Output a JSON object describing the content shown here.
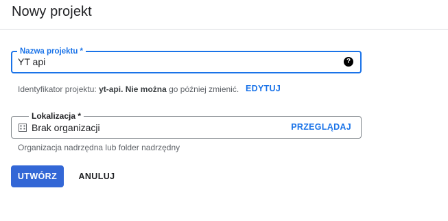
{
  "header": {
    "title": "Nowy projekt"
  },
  "project_name": {
    "label": "Nazwa projektu *",
    "value": "YT api",
    "help_icon": "help-icon"
  },
  "project_id_hint": {
    "prefix": "Identyfikator projektu:",
    "id": "yt-api.",
    "strong": "Nie można",
    "suffix": "go później zmienić.",
    "edit_label": "EDYTUJ"
  },
  "location": {
    "label": "Lokalizacja *",
    "icon": "building-icon",
    "value": "Brak organizacji",
    "browse_label": "PRZEGLĄDAJ",
    "hint": "Organizacja nadrzędna lub folder nadrzędny"
  },
  "actions": {
    "create_label": "UTWÓRZ",
    "cancel_label": "ANULUJ"
  },
  "colors": {
    "accent": "#1a73e8",
    "primary_button": "#3367d6"
  }
}
